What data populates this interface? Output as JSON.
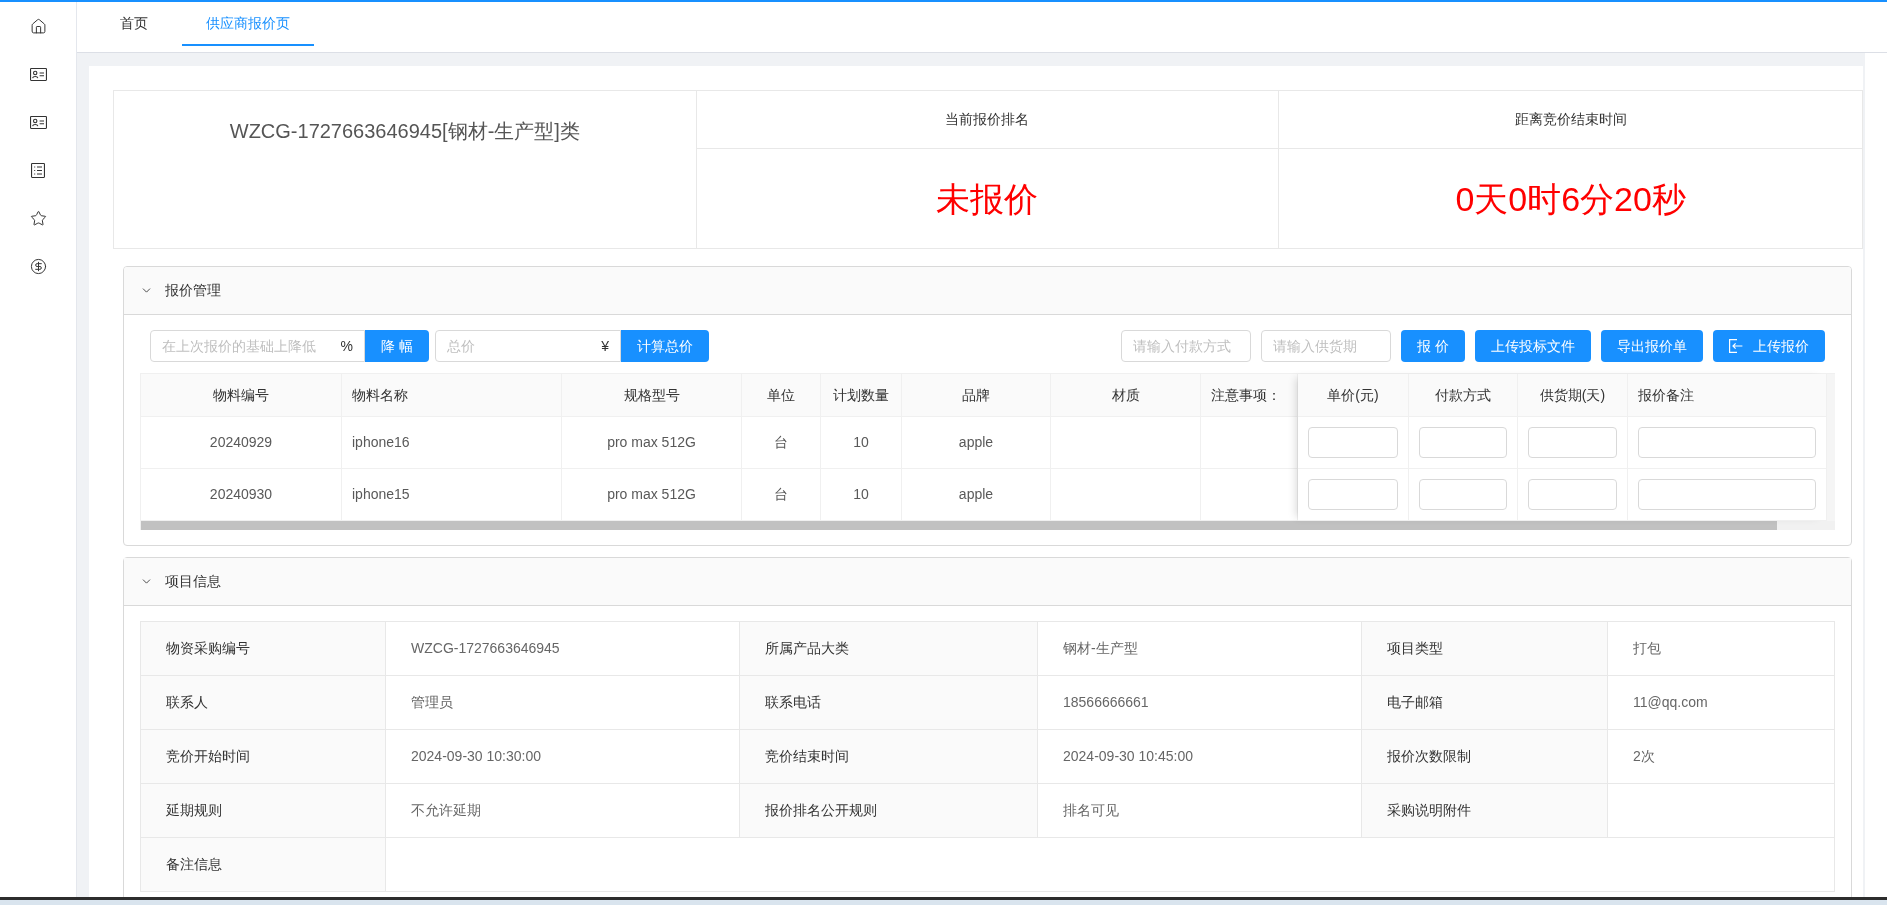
{
  "tabs": [
    {
      "label": "首页",
      "selected": false
    },
    {
      "label": "供应商报价页",
      "selected": true
    }
  ],
  "summary": {
    "title": "WZCG-1727663646945[钢材-生产型]类",
    "stats": [
      {
        "label": "当前报价排名",
        "value": "未报价"
      },
      {
        "label": "距离竞价结束时间",
        "value": "0天0时6分20秒"
      }
    ]
  },
  "quote_panel": {
    "title": "报价管理",
    "expanded": true,
    "toolbar": {
      "discount_field": {
        "placeholder": "在上次报价的基础上降低",
        "suffix": "%"
      },
      "discount_button": "降 幅",
      "total_field": {
        "placeholder": "总价",
        "suffix": "¥"
      },
      "total_button": "计算总价",
      "payment_field": {
        "placeholder": "请输入付款方式"
      },
      "delivery_field": {
        "placeholder": "请输入供货期"
      },
      "buttons": [
        {
          "label": "报 价",
          "kind": "text"
        },
        {
          "label": "上传投标文件",
          "kind": "text"
        },
        {
          "label": "导出报价单",
          "kind": "text"
        },
        {
          "label": "上传报价",
          "kind": "icon"
        }
      ]
    },
    "table": {
      "columns": [
        "物料编号",
        "物料名称",
        "规格型号",
        "单位",
        "计划数量",
        "品牌",
        "材质",
        "注意事项："
      ],
      "input_columns": [
        "单价(元)",
        "付款方式",
        "供货期(天)",
        "报价备注"
      ],
      "rows": [
        {
          "cells": [
            "20240929",
            "iphone16",
            "pro max 512G",
            "台",
            "10",
            "apple"
          ]
        },
        {
          "cells": [
            "20240930",
            "iphone15",
            "pro max 512G",
            "台",
            "10",
            "apple"
          ]
        }
      ]
    }
  },
  "info_panel": {
    "title": "项目信息",
    "expanded": true,
    "rows": [
      {
        "items": [
          {
            "label": "物资采购编号",
            "value": "WZCG-1727663646945"
          },
          {
            "label": "所属产品大类",
            "value": "钢材-生产型"
          },
          {
            "label": "项目类型",
            "value": "打包"
          }
        ]
      },
      {
        "items": [
          {
            "label": "联系人",
            "value": "管理员"
          },
          {
            "label": "联系电话",
            "value": "18566666661"
          },
          {
            "label": "电子邮箱",
            "value": "11@qq.com"
          }
        ]
      },
      {
        "items": [
          {
            "label": "竞价开始时间",
            "value": "2024-09-30 10:30:00"
          },
          {
            "label": "竞价结束时间",
            "value": "2024-09-30 10:45:00"
          },
          {
            "label": "报价次数限制",
            "value": "2次"
          }
        ]
      },
      {
        "items": [
          {
            "label": "延期规则",
            "value": "不允许延期"
          },
          {
            "label": "报价排名公开规则",
            "value": "排名可见"
          },
          {
            "label": "采购说明附件"
          }
        ]
      },
      {
        "items": [
          {
            "label": "备注信息"
          }
        ]
      }
    ]
  }
}
